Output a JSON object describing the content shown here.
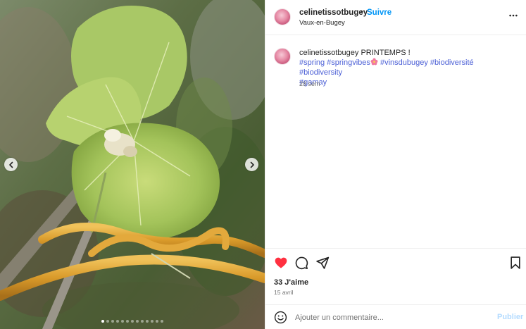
{
  "post": {
    "username": "celinetissotbugey",
    "separator": "•",
    "follow_label": "Suivre",
    "location": "Vaux-en-Bugey",
    "more_icon": "more-horizontal-icon"
  },
  "caption": {
    "username": "celinetissotbugey",
    "text": "PRINTEMPS !",
    "hashtags_line1": [
      "#spring",
      "#springvibes"
    ],
    "hashtags_line1b": [
      "#vinsdubugey",
      "#biodiversité",
      "#biodiversity"
    ],
    "hashtags_line2": [
      "#gamay"
    ],
    "time_ago": "28 sem"
  },
  "actions": {
    "like_icon": "heart-filled-icon",
    "comment_icon": "comment-icon",
    "share_icon": "send-icon",
    "save_icon": "bookmark-icon",
    "likes_text": "33 J'aime",
    "date": "15 avril"
  },
  "comment": {
    "placeholder": "Ajouter un commentaire...",
    "publish_label": "Publier",
    "emoji_icon": "smiley-icon"
  },
  "carousel": {
    "slide_count": 13,
    "active_index": 0
  },
  "colors": {
    "accent": "#0095f6",
    "like_red": "#ff3040",
    "hashtag": "#4b5fd6",
    "publish_disabled": "#b3dbff"
  }
}
